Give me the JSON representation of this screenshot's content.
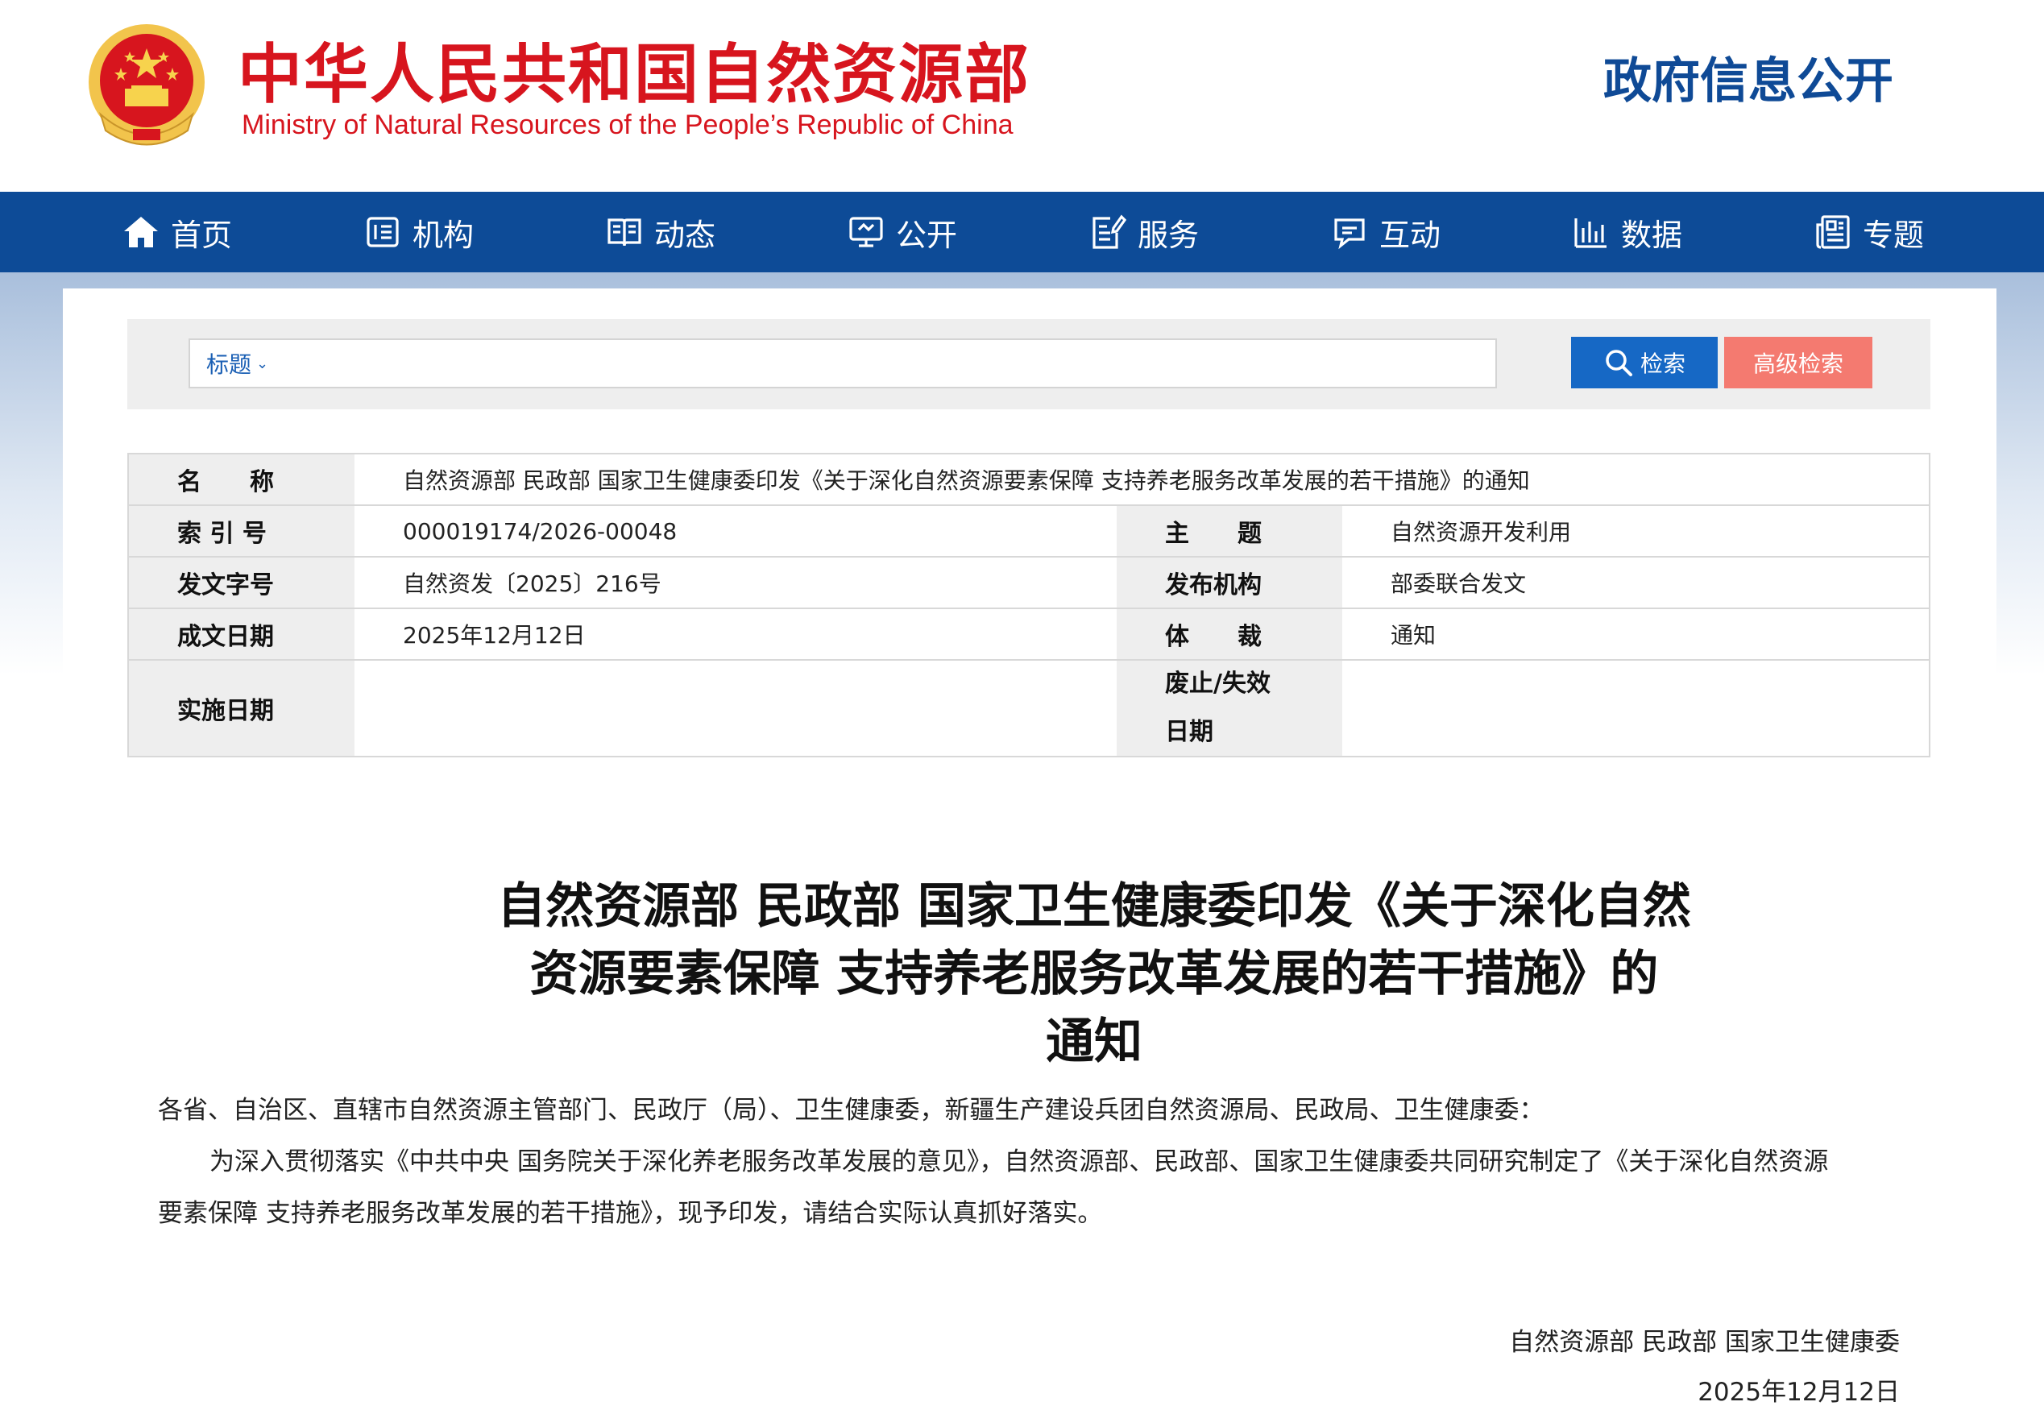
{
  "header": {
    "title_cn": "中华人民共和国自然资源部",
    "title_en": "Ministry of Natural Resources of the People’s Republic of China",
    "section": "政府信息公开",
    "brand_red": "#d7151e",
    "brand_blue": "#0d4b97"
  },
  "nav": {
    "items": [
      {
        "label": "首页",
        "icon": "home-icon"
      },
      {
        "label": "机构",
        "icon": "org-icon"
      },
      {
        "label": "动态",
        "icon": "book-icon"
      },
      {
        "label": "公开",
        "icon": "monitor-icon"
      },
      {
        "label": "服务",
        "icon": "edit-doc-icon"
      },
      {
        "label": "互动",
        "icon": "chat-icon"
      },
      {
        "label": "数据",
        "icon": "bar-chart-icon"
      },
      {
        "label": "专题",
        "icon": "newspaper-icon"
      }
    ]
  },
  "search": {
    "type_label": "标题",
    "placeholder": "",
    "search_button": "检索",
    "advanced_button": "高级检索"
  },
  "meta": {
    "name_label": "名　　称",
    "name_value": "自然资源部 民政部 国家卫生健康委印发《关于深化自然资源要素保障 支持养老服务改革发展的若干措施》的通知",
    "index_label": "索 引 号",
    "index_value": "000019174/2026-00048",
    "topic_label": "主　　题",
    "topic_value": "自然资源开发利用",
    "docno_label": "发文字号",
    "docno_value": "自然资发〔2025〕216号",
    "issuer_label": "发布机构",
    "issuer_value": "部委联合发文",
    "date_label": "成文日期",
    "date_value": "2025年12月12日",
    "genre_label": "体　　裁",
    "genre_value": "通知",
    "effective_label": "实施日期",
    "effective_value": "",
    "expiry_label_1": "废止/失效",
    "expiry_label_2": "日期",
    "expiry_value": ""
  },
  "article": {
    "title_lines": [
      "自然资源部 民政部 国家卫生健康委印发《关于深化自然",
      "资源要素保障 支持养老服务改革发展的若干措施》的",
      "通知"
    ],
    "salutation": "各省、自治区、直辖市自然资源主管部门、民政厅（局）、卫生健康委，新疆生产建设兵团自然资源局、民政局、卫生健康委：",
    "body_line_1": "为深入贯彻落实《中共中央 国务院关于深化养老服务改革发展的意见》，自然资源部、民政部、国家卫生健康委共同研究制定了《关于深化自然资源",
    "body_line_2": "要素保障 支持养老服务改革发展的若干措施》，现予印发，请结合实际认真抓好落实。",
    "signature": "自然资源部 民政部 国家卫生健康委",
    "sign_date": "2025年12月12日"
  }
}
